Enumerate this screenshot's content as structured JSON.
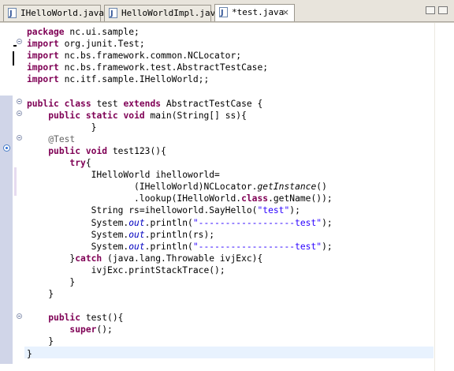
{
  "tabs": [
    {
      "label": "IHelloWorld.java",
      "active": false
    },
    {
      "label": "HelloWorldImpl.java",
      "active": false
    },
    {
      "label": "*test.java",
      "active": true,
      "close_glyph": "×"
    }
  ],
  "colors": {
    "keyword": "#7f0055",
    "string": "#2a00ff",
    "annotation": "#646464",
    "static_field": "#0000c0",
    "current_line": "#e8f2fe",
    "overview_ruler": "#d0d5e8"
  },
  "code": {
    "line1": "package nc.ui.sample;",
    "line2": "import org.junit.Test;",
    "line3": "import nc.bs.framework.common.NCLocator;",
    "line4": "import nc.bs.framework.test.AbstractTestCase;",
    "line5": "import nc.itf.sample.IHelloWorld;;",
    "line7": "public class test extends AbstractTestCase {",
    "line8": "public static void main(String[] ss){",
    "line9": "}",
    "line10": "@Test",
    "line11": "public void test123(){",
    "line12": "try{",
    "line13": "IHelloWorld ihelloworld=",
    "line14": "(IHelloWorld)NCLocator.getInstance()",
    "line15": ".lookup(IHelloWorld.class.getName());",
    "line16": "String rs=ihelloworld.SayHello(\"test\");",
    "line17": "System.out.println(\"------------------test\");",
    "line18": "System.out.println(rs);",
    "line19": "System.out.println(\"------------------test\");",
    "line20": "}catch (java.lang.Throwable ivjExc){",
    "line21": "ivjExc.printStackTrace();",
    "line22": "}",
    "line23": "}",
    "line25": "public test(){",
    "line26": "super();",
    "line27": "}",
    "line28": "}"
  },
  "tokens": {
    "package": "package",
    "import": "import",
    "public": "public",
    "class": "class",
    "extends": "extends",
    "static": "static",
    "void": "void",
    "try": "try",
    "catch": "catch",
    "super": "super",
    "ann_test": "@Test",
    "out": "out",
    "getInstance": "getInstance",
    "class_kw": "class",
    "str_test": "\"test\"",
    "str_dash": "\"------------------test\""
  }
}
